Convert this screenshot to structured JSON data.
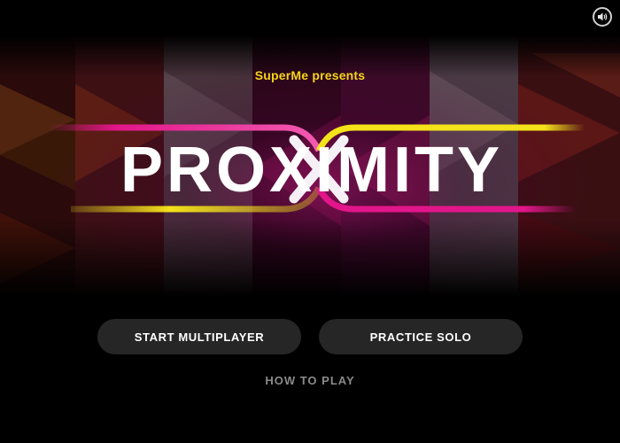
{
  "header": {
    "presents_text": "SuperMe presents",
    "presents_color": "#f5d31b"
  },
  "logo": {
    "title": "PROXIMITY",
    "stripe_pink": "#e2168a",
    "stripe_yellow": "#f4e21b"
  },
  "controls": {
    "sound_icon": "speaker-icon"
  },
  "menu": {
    "start_multiplayer": "START MULTIPLAYER",
    "practice_solo": "PRACTICE SOLO",
    "how_to_play": "HOW TO PLAY"
  }
}
